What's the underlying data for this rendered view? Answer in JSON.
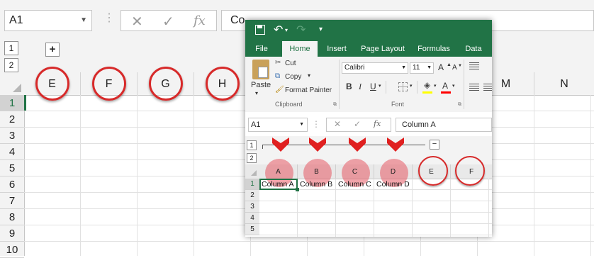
{
  "background_sheet": {
    "name_box": "A1",
    "formula_cancel": "✕",
    "formula_enter": "✓",
    "formula_fx": "fx",
    "formula_value": "Co",
    "outline_levels": [
      "1",
      "2"
    ],
    "expand_button": "+",
    "columns": [
      "E",
      "F",
      "G",
      "H",
      "M",
      "N"
    ],
    "rows": [
      "1",
      "2",
      "3",
      "4",
      "5",
      "6",
      "7",
      "8",
      "9",
      "10"
    ],
    "annotation_color": "#d72a2a"
  },
  "window": {
    "qat_save_icon": "save-icon",
    "qat_undo": "↶",
    "qat_redo": "↷",
    "qat_customize": "▾",
    "tabs": [
      "File",
      "Home",
      "Insert",
      "Page Layout",
      "Formulas",
      "Data"
    ],
    "active_tab": "Home",
    "clipboard": {
      "paste": "Paste",
      "cut": "Cut",
      "copy": "Copy",
      "format_painter": "Format Painter",
      "group_label": "Clipboard"
    },
    "font": {
      "family": "Calibri",
      "size": "11",
      "grow": "A",
      "shrink": "A",
      "bold": "B",
      "italic": "I",
      "underline": "U",
      "font_color_letter": "A",
      "group_label": "Font",
      "fill_color": "#ffff00",
      "font_color": "#ff0000"
    },
    "name_box": "A1",
    "formula_value": "Column A",
    "formula_fx": "fx",
    "outline_levels": [
      "1",
      "2"
    ],
    "collapse_button": "−",
    "columns": [
      "A",
      "B",
      "C",
      "D",
      "E",
      "F"
    ],
    "rows": [
      "1",
      "2",
      "3",
      "4",
      "5"
    ],
    "cells_row1": [
      "Column A",
      "Column B",
      "Column C",
      "Column D"
    ],
    "accent": "#217346"
  }
}
